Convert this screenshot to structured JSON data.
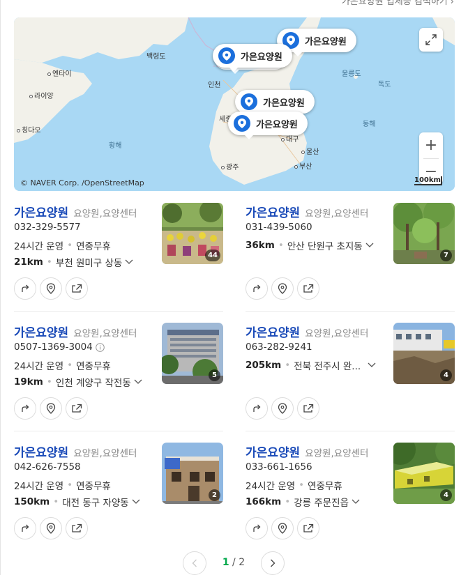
{
  "header": {
    "top_link": "가은요양원 업체등 검색하기 ›"
  },
  "map": {
    "copyright": "© NAVER Corp. /OpenStreetMap",
    "scale": "100km",
    "labels": {
      "baengnyeong": "백령도",
      "yantai": "옌타이",
      "laiyang": "라이양",
      "qingdao": "칭다오",
      "incheon": "인천",
      "sejong": "세종",
      "daegu": "대구",
      "ulsan": "울산",
      "busan": "부산",
      "gwangju": "광주",
      "ulleungdo": "울릉도",
      "dokdo": "독도",
      "east_sea": "동해",
      "yellow_sea": "황해"
    },
    "pins": [
      "가은요양원",
      "가은요양원",
      "가은요양원",
      "가은요양원"
    ],
    "zoom_in": "+",
    "zoom_out": "−"
  },
  "results": [
    {
      "name": "가은요양원",
      "category": "요양원,요양센터",
      "phone": "032-329-5577",
      "hours": "24시간 운영",
      "holiday": "연중무휴",
      "distance": "21km",
      "address": "부천 원미구 상동",
      "photo_count": "44"
    },
    {
      "name": "가은요양원",
      "category": "요양원,요양센터",
      "phone": "031-439-5060",
      "hours": "",
      "holiday": "",
      "distance": "36km",
      "address": "안산 단원구 초지동",
      "photo_count": "7"
    },
    {
      "name": "가은요양원",
      "category": "요양원,요양센터",
      "phone": "0507-1369-3004",
      "hours": "24시간 운영",
      "holiday": "연중무휴",
      "distance": "19km",
      "address": "인천 계양구 작전동",
      "photo_count": "5"
    },
    {
      "name": "가은요양원",
      "category": "요양원,요양센터",
      "phone": "063-282-9241",
      "hours": "",
      "holiday": "",
      "distance": "205km",
      "address": "전북 전주시 완...",
      "photo_count": "4"
    },
    {
      "name": "가은요양원",
      "category": "요양원,요양센터",
      "phone": "042-626-7558",
      "hours": "24시간 운영",
      "holiday": "연중무휴",
      "distance": "150km",
      "address": "대전 동구 자양동",
      "photo_count": "2"
    },
    {
      "name": "가은요양원",
      "category": "요양원,요양센터",
      "phone": "033-661-1656",
      "hours": "24시간 운영",
      "holiday": "연중무휴",
      "distance": "166km",
      "address": "강릉 주문진읍",
      "photo_count": "4"
    }
  ],
  "pagination": {
    "current": "1",
    "separator": "/",
    "total": "2"
  },
  "colors": {
    "title_blue": "#1a4ab8",
    "pin_blue": "#1b6fdc",
    "page_green": "#03a94d",
    "sea": "#a9d8f4",
    "land": "#f2f1ea"
  }
}
